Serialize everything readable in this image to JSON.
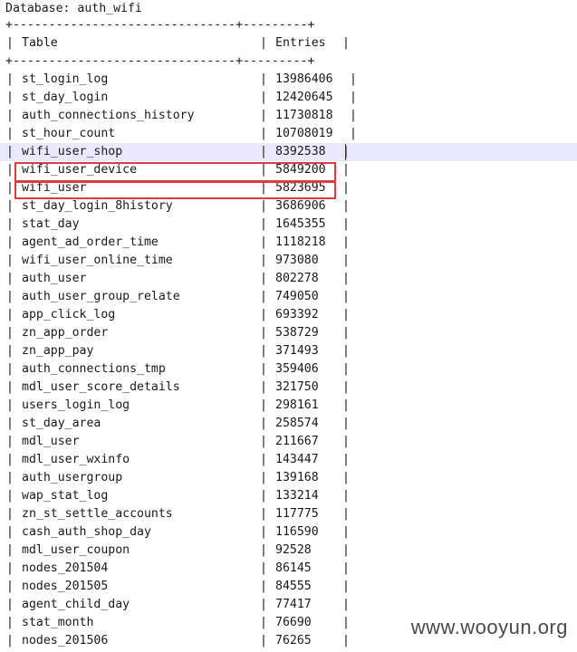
{
  "header": {
    "database_line": "Database: auth_wifi",
    "border_line": "+-------------------------------+---------+",
    "col_table": "Table",
    "col_entries": "Entries"
  },
  "rows": [
    {
      "name": "st_login_log",
      "entries": "13986406"
    },
    {
      "name": "st_day_login",
      "entries": "12420645"
    },
    {
      "name": "auth_connections_history",
      "entries": "11730818"
    },
    {
      "name": "st_hour_count",
      "entries": "10708019"
    },
    {
      "name": "wifi_user_shop",
      "entries": "8392538"
    },
    {
      "name": "wifi_user_device",
      "entries": "5849200"
    },
    {
      "name": "wifi_user",
      "entries": "5823695"
    },
    {
      "name": "st_day_login_8history",
      "entries": "3686906"
    },
    {
      "name": "stat_day",
      "entries": "1645355"
    },
    {
      "name": "agent_ad_order_time",
      "entries": "1118218"
    },
    {
      "name": "wifi_user_online_time",
      "entries": "973080"
    },
    {
      "name": "auth_user",
      "entries": "802278"
    },
    {
      "name": "auth_user_group_relate",
      "entries": "749050"
    },
    {
      "name": "app_click_log",
      "entries": "693392"
    },
    {
      "name": "zn_app_order",
      "entries": "538729"
    },
    {
      "name": "zn_app_pay",
      "entries": "371493"
    },
    {
      "name": "auth_connections_tmp",
      "entries": "359406"
    },
    {
      "name": "mdl_user_score_details",
      "entries": "321750"
    },
    {
      "name": "users_login_log",
      "entries": "298161"
    },
    {
      "name": "st_day_area",
      "entries": "258574"
    },
    {
      "name": "mdl_user",
      "entries": "211667"
    },
    {
      "name": "mdl_user_wxinfo",
      "entries": "143447"
    },
    {
      "name": "auth_usergroup",
      "entries": "139168"
    },
    {
      "name": "wap_stat_log",
      "entries": "133214"
    },
    {
      "name": "zn_st_settle_accounts",
      "entries": "117775"
    },
    {
      "name": "cash_auth_shop_day",
      "entries": "116590"
    },
    {
      "name": "mdl_user_coupon",
      "entries": "92528"
    },
    {
      "name": "nodes_201504",
      "entries": "86145"
    },
    {
      "name": "nodes_201505",
      "entries": "84555"
    },
    {
      "name": "agent_child_day",
      "entries": "77417"
    },
    {
      "name": "stat_month",
      "entries": "76690"
    },
    {
      "name": "nodes_201506",
      "entries": "76265"
    }
  ],
  "highlighted_row": "wifi_user_shop",
  "boxed_rows": [
    "wifi_user_device",
    "wifi_user"
  ],
  "box_color": "#e0393e",
  "highlight_color": "#e8e8ff",
  "watermark": "www.wooyun.org"
}
